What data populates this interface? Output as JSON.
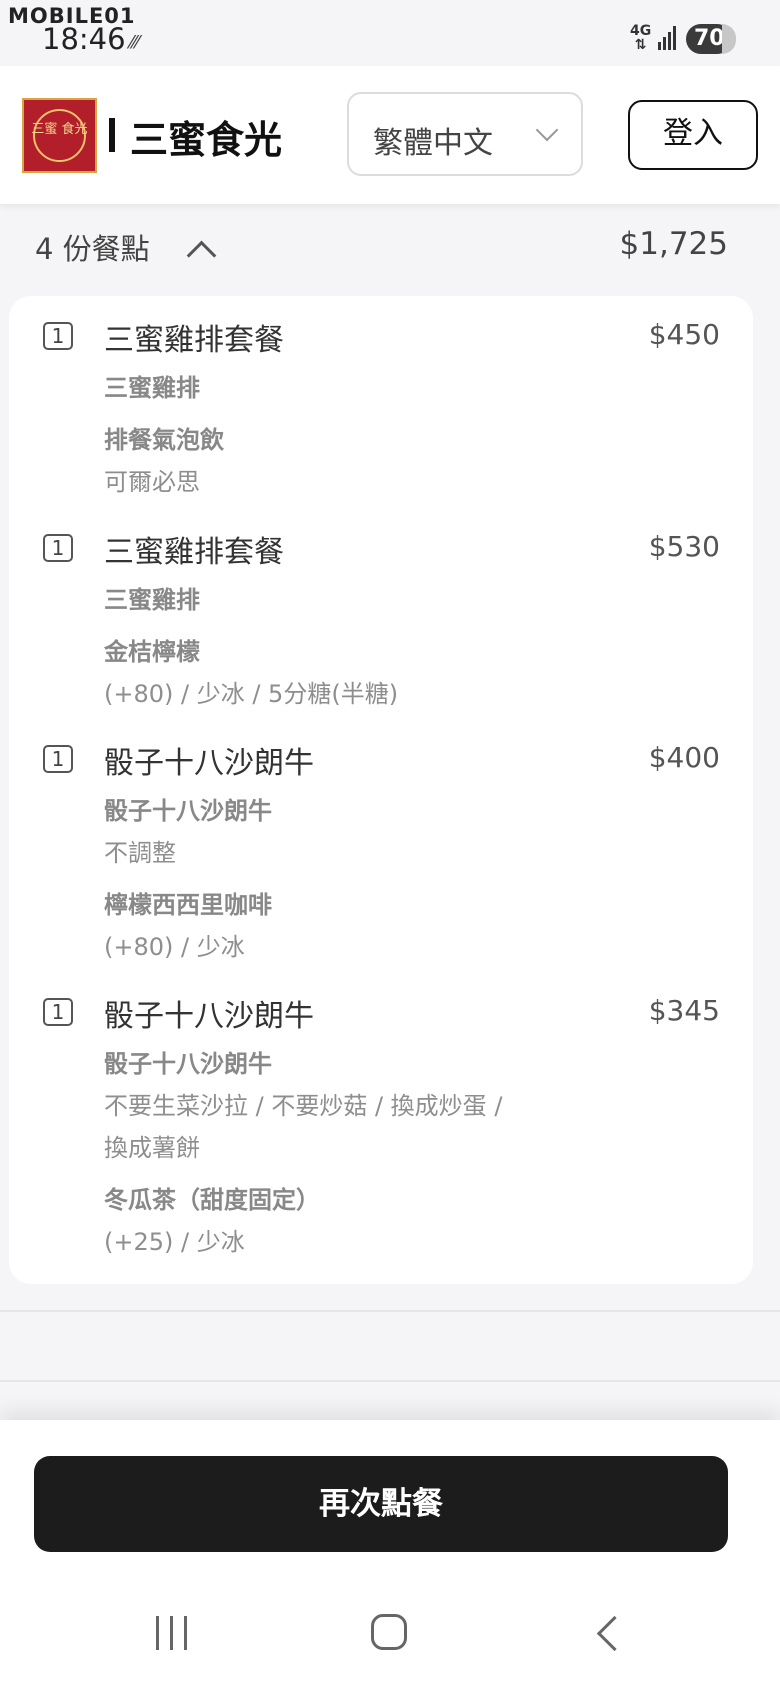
{
  "status_bar": {
    "watermark": "MOBILE01",
    "time": "18:46",
    "network": "4G",
    "battery": "70"
  },
  "header": {
    "logo_text": "三蜜 食光",
    "restaurant_name": "三蜜食光",
    "language": "繁體中文",
    "login_label": "登入"
  },
  "summary": {
    "items_count_label": "4 份餐點",
    "total": "$1,725"
  },
  "order_items": [
    {
      "qty": "1",
      "name": "三蜜雞排套餐",
      "price": "$450",
      "lines": [
        {
          "type": "sub",
          "text": "三蜜雞排"
        },
        {
          "type": "sub",
          "text": "排餐氣泡飲"
        },
        {
          "type": "opt",
          "text": "可爾必思"
        }
      ]
    },
    {
      "qty": "1",
      "name": "三蜜雞排套餐",
      "price": "$530",
      "lines": [
        {
          "type": "sub",
          "text": "三蜜雞排"
        },
        {
          "type": "sub",
          "text": "金桔檸檬"
        },
        {
          "type": "opt",
          "text": "(+80)  / 少冰 / 5分糖(半糖)"
        }
      ]
    },
    {
      "qty": "1",
      "name": "骰子十八沙朗牛",
      "price": "$400",
      "lines": [
        {
          "type": "sub",
          "text": "骰子十八沙朗牛"
        },
        {
          "type": "opt",
          "text": "不調整"
        },
        {
          "type": "sub",
          "text": "檸檬西西里咖啡"
        },
        {
          "type": "opt",
          "text": "(+80)  / 少冰"
        }
      ]
    },
    {
      "qty": "1",
      "name": "骰子十八沙朗牛",
      "price": "$345",
      "lines": [
        {
          "type": "sub",
          "text": "骰子十八沙朗牛"
        },
        {
          "type": "opt",
          "text": "不要生菜沙拉 / 不要炒菇 / 換成炒蛋 /"
        },
        {
          "type": "opt",
          "text": "換成薯餅"
        },
        {
          "type": "sub",
          "text": "冬瓜茶（甜度固定）"
        },
        {
          "type": "opt",
          "text": "(+25)  / 少冰"
        }
      ]
    }
  ],
  "actions": {
    "reorder_label": "再次點餐"
  }
}
